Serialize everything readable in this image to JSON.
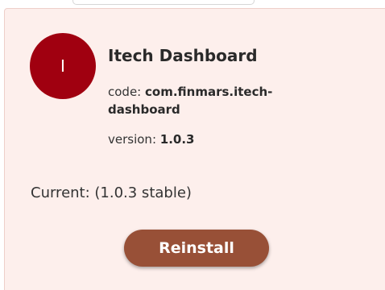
{
  "app": {
    "avatar_letter": "I",
    "name": "Itech Dashboard",
    "code_label": "code:",
    "code_value": "com.finmars.itech-dashboard",
    "version_label": "version:",
    "version_value": "1.0.3",
    "current_text": "Current: (1.0.3 stable)",
    "reinstall_label": "Reinstall"
  },
  "colors": {
    "card_background": "#fdefec",
    "avatar": "#a00010",
    "button": "#985037"
  }
}
